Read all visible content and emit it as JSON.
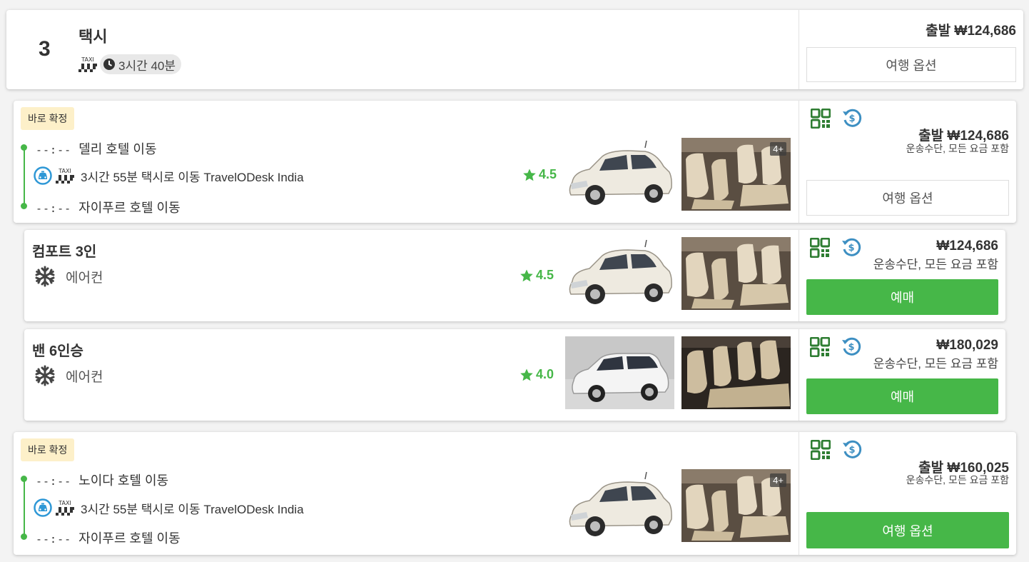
{
  "summary": {
    "number": "3",
    "mode": "택시",
    "taxi_label": "TAXI",
    "duration": "3시간 40분",
    "price": "출발 ₩124,686",
    "options_button": "여행 옵션"
  },
  "route1": {
    "badge": "바로 확정",
    "from_time": "--:--",
    "from": "델리 호텔 이동",
    "taxi_label": "TAXI",
    "segment": "3시간 55분 택시로 이동 TravelODesk India",
    "to_time": "--:--",
    "to": "자이푸르 호텔 이동",
    "rating": "4.5",
    "photo_count": "4+",
    "price": "출발 ₩124,686",
    "price_note": "운송수단, 모든 요금 포함",
    "options_button": "여행 옵션"
  },
  "vehicles": [
    {
      "title": "컴포트 3인",
      "amenity": "에어컨",
      "rating": "4.5",
      "price": "₩124,686",
      "price_note": "운송수단, 모든 요금 포함",
      "book_button": "예매"
    },
    {
      "title": "밴 6인승",
      "amenity": "에어컨",
      "rating": "4.0",
      "price": "₩180,029",
      "price_note": "운송수단, 모든 요금 포함",
      "book_button": "예매"
    }
  ],
  "route2": {
    "badge": "바로 확정",
    "from_time": "--:--",
    "from": "노이다 호텔 이동",
    "taxi_label": "TAXI",
    "segment": "3시간 55분 택시로 이동 TravelODesk India",
    "to_time": "--:--",
    "to": "자이푸르 호텔 이동",
    "photo_count": "4+",
    "price": "출발 ₩160,025",
    "price_note": "운송수단, 모든 요금 포함",
    "options_button": "여행 옵션"
  },
  "colors": {
    "accent_green": "#46b748",
    "badge_bg": "#fdf0c9",
    "icon_dark_green": "#2e7d32",
    "icon_blue": "#3d8fc2"
  }
}
